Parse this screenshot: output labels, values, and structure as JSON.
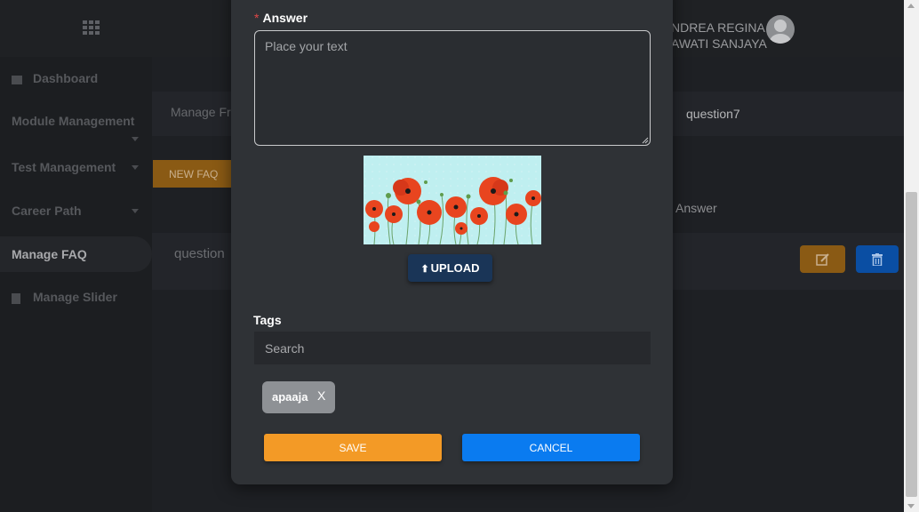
{
  "topbar": {
    "menu_icon": "grid-icon",
    "user_name_line1": "NDREA REGINA",
    "user_name_line2": "AWATI SANJAYA",
    "avatar_icon": "user-avatar-icon"
  },
  "sidebar": {
    "items": [
      {
        "label": "Dashboard",
        "icon": "dashboard-icon"
      },
      {
        "label": "Module Management",
        "icon": "chevron-down-icon"
      },
      {
        "label": "Test Management",
        "icon": "chevron-down-icon"
      },
      {
        "label": "Career Path",
        "icon": "chevron-down-icon"
      },
      {
        "label": "Manage FAQ",
        "active": true
      },
      {
        "label": "Manage Slider",
        "icon": "slider-icon"
      }
    ]
  },
  "content": {
    "breadcrumb": "Manage Fr",
    "question_title": "question7",
    "new_faq_label": "NEW FAQ",
    "answer_column": "Answer",
    "row_question": "question",
    "edit_icon": "edit-icon",
    "delete_icon": "trash-icon"
  },
  "modal": {
    "answer_required_mark": "*",
    "answer_label": "Answer",
    "answer_placeholder": "Place your text",
    "image_alt": "poppies image",
    "upload_icon": "upload-icon",
    "upload_label": "UPLOAD",
    "tags_label": "Tags",
    "tags_placeholder": "Search",
    "tags": [
      {
        "text": "apaaja",
        "remove": "X"
      }
    ],
    "save_label": "SAVE",
    "cancel_label": "CANCEL"
  },
  "colors": {
    "save": "#f39a26",
    "cancel": "#0a7bf0",
    "upload": "#1a3557",
    "required": "#e04646"
  }
}
